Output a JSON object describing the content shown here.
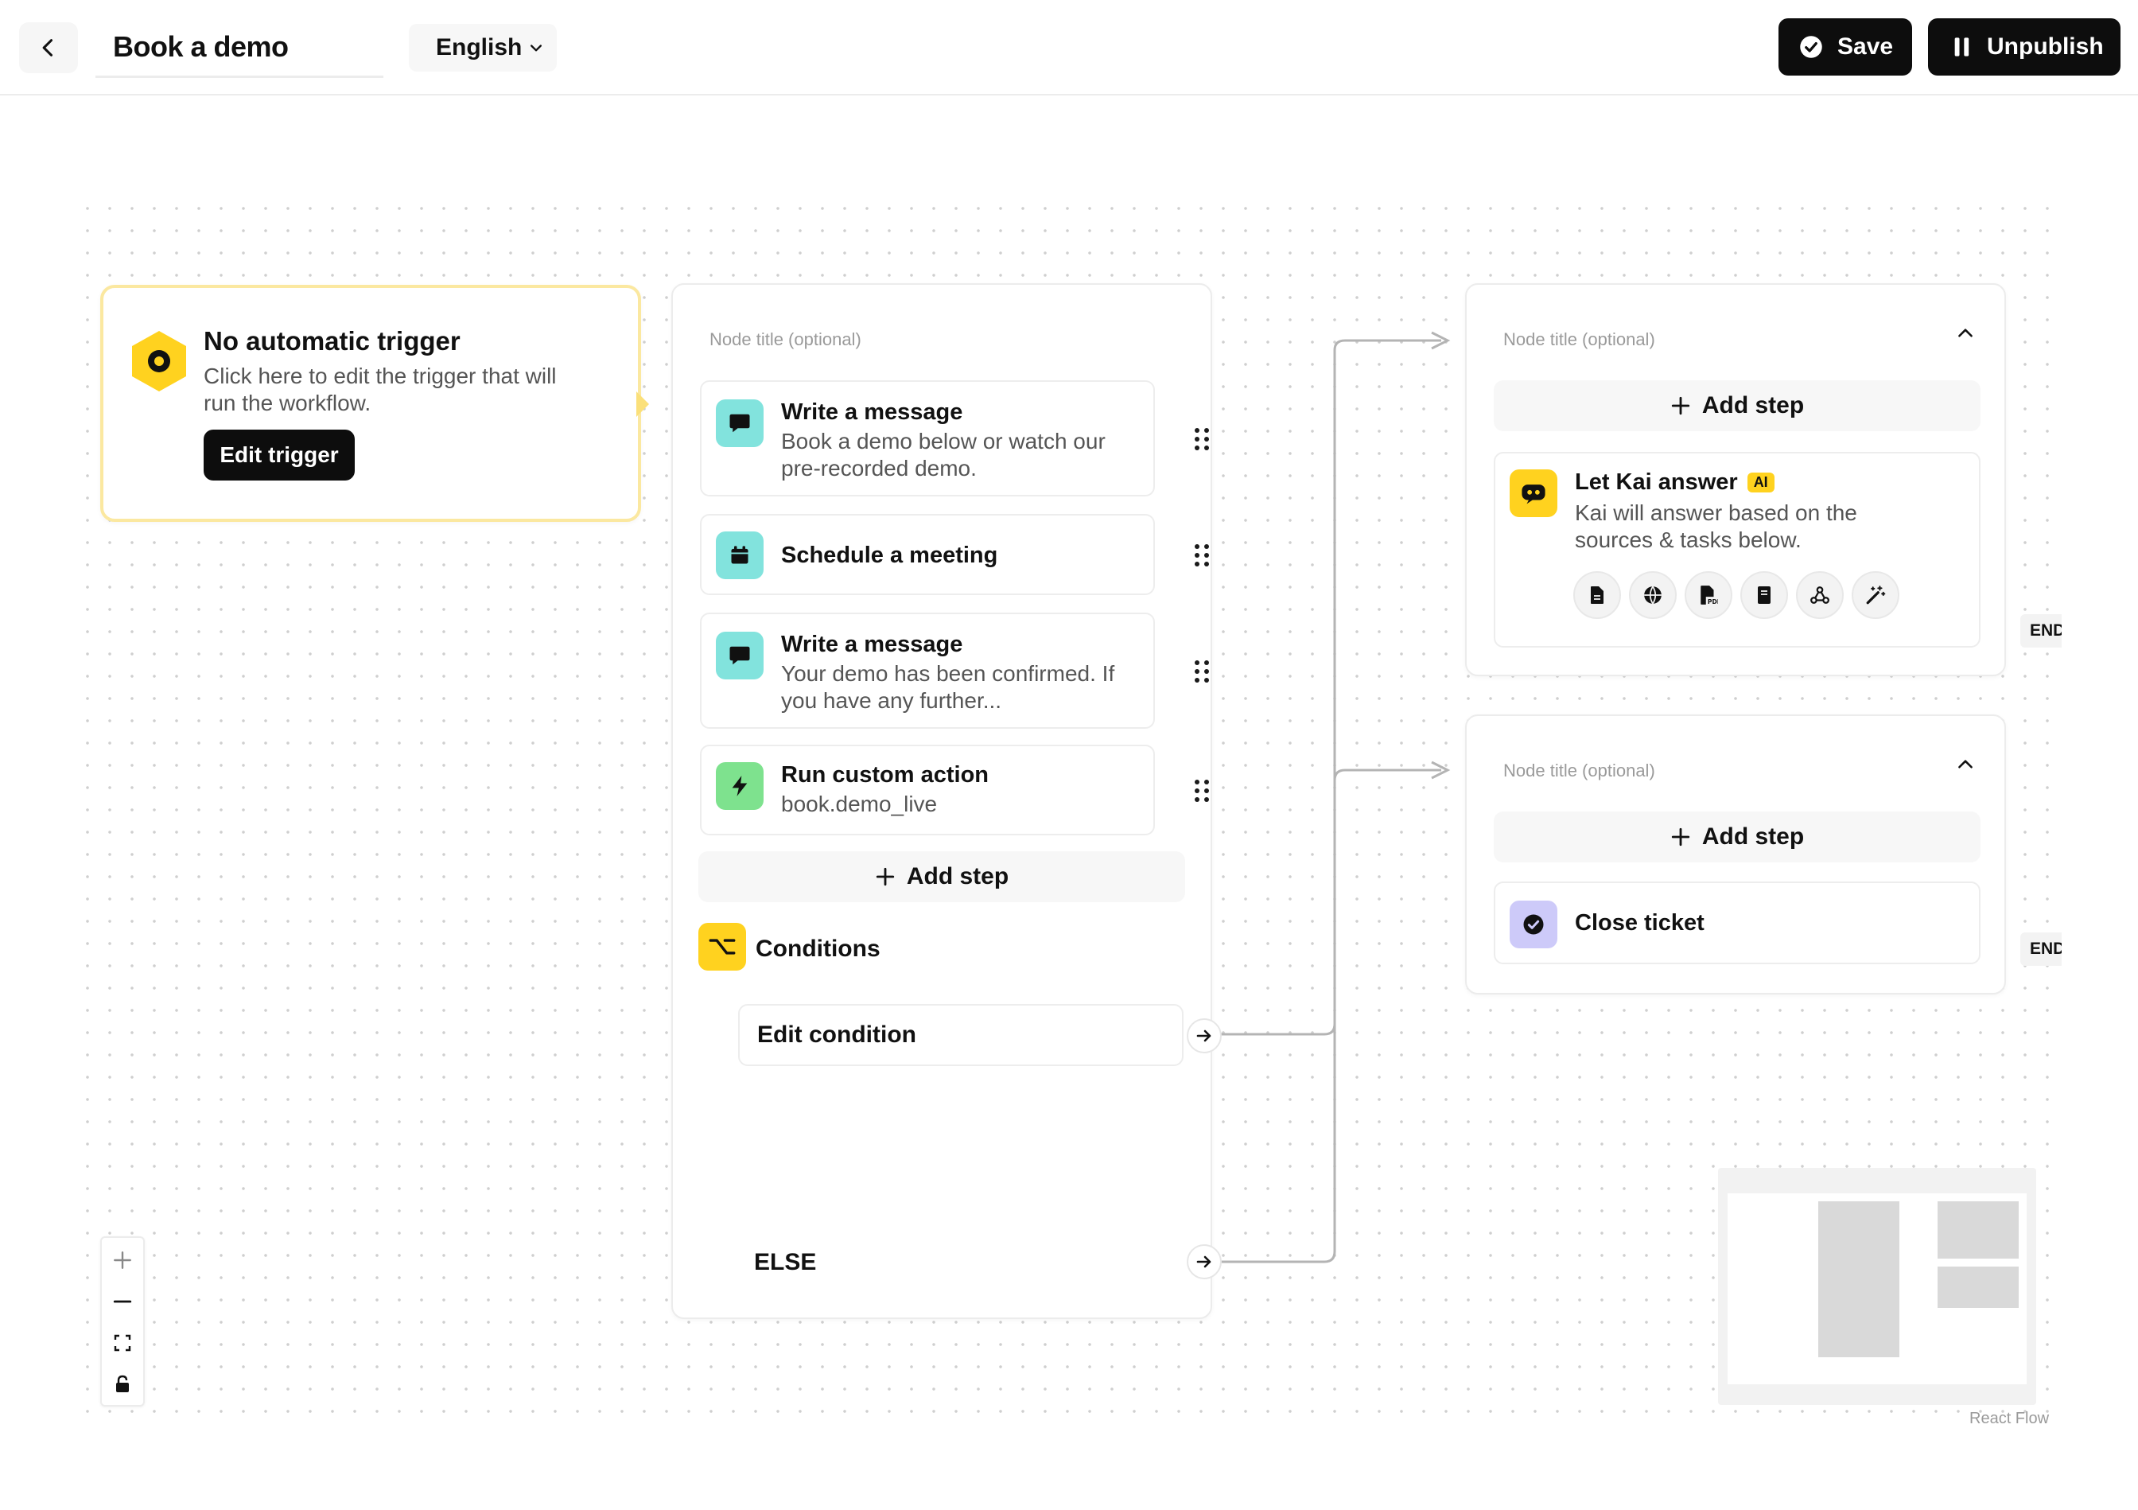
{
  "header": {
    "workflow_title": "Book a demo",
    "language": "English",
    "save_label": "Save",
    "unpublish_label": "Unpublish"
  },
  "trigger": {
    "title": "No automatic trigger",
    "description": "Click here to edit the trigger that will run the workflow.",
    "button_label": "Edit trigger"
  },
  "main_node": {
    "title_placeholder": "Node title (optional)",
    "steps": [
      {
        "title": "Write a message",
        "subtitle": "Book a demo below or watch our pre-recorded demo.",
        "icon": "message-icon"
      },
      {
        "title": "Schedule a meeting",
        "subtitle": "",
        "icon": "calendar-icon"
      },
      {
        "title": "Write a message",
        "subtitle": "Your demo has been confirmed. If you have any further...",
        "icon": "message-icon"
      },
      {
        "title": "Run custom action",
        "subtitle": "book.demo_live",
        "icon": "lightning-icon"
      }
    ],
    "add_step_label": "Add step",
    "conditions_label": "Conditions",
    "edit_condition_label": "Edit condition",
    "else_label": "ELSE"
  },
  "branch_top": {
    "title_placeholder": "Node title (optional)",
    "add_step_label": "Add step",
    "kai_title": "Let Kai answer",
    "ai_badge": "AI",
    "kai_description": "Kai will answer based on the sources & tasks below.",
    "source_icons": [
      "document-icon",
      "globe-icon",
      "pdf-icon",
      "book-icon",
      "webhook-icon",
      "magic-wand-icon"
    ]
  },
  "branch_bottom": {
    "title_placeholder": "Node title (optional)",
    "add_step_label": "Add step",
    "close_ticket_label": "Close ticket"
  },
  "end_tags": [
    "END",
    "END"
  ],
  "minimap_attribution": "React Flow",
  "colors": {
    "accent_yellow": "#ffd21f",
    "teal": "#82e3dd",
    "green": "#7ee28e",
    "lavender": "#cdcaf9",
    "dark": "#0d0d0d"
  }
}
